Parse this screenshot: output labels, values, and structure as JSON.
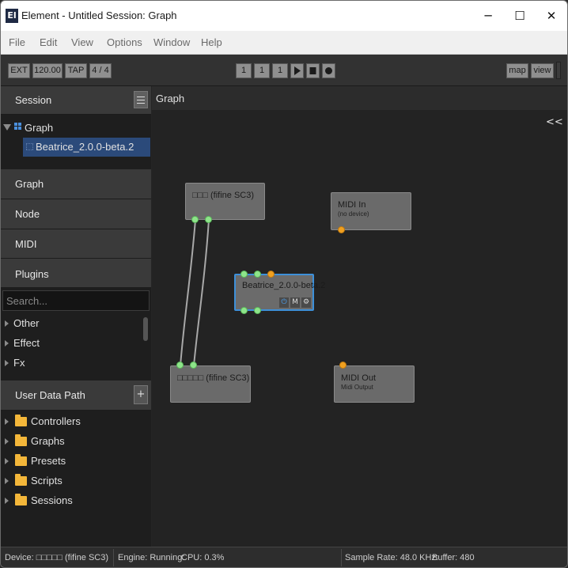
{
  "window": {
    "title": "Element - Untitled Session: Graph",
    "logo_text": "El",
    "minimize": "─",
    "maximize": "☐",
    "close": "✕"
  },
  "menu": [
    "File",
    "Edit",
    "View",
    "Options",
    "Window",
    "Help"
  ],
  "toolbar": {
    "ext": "EXT",
    "tempo": "120.00",
    "tap": "TAP",
    "meter": "4 / 4",
    "pos_bar": "1",
    "pos_beat": "1",
    "pos_tick": "1",
    "map": "map",
    "view": "view",
    "icons": [
      "play-icon",
      "stop-icon",
      "record-icon"
    ]
  },
  "sidebar": {
    "session_label": "Session",
    "tree": {
      "root": "Graph",
      "child": "Beatrice_2.0.0-beta.2"
    },
    "sections": [
      "Graph",
      "Node",
      "MIDI",
      "Plugins"
    ],
    "search_placeholder": "Search...",
    "plugin_categories": [
      "Other",
      "Effect",
      "Fx"
    ],
    "user_data_label": "User Data Path",
    "user_data_add": "+",
    "folders": [
      "Controllers",
      "Graphs",
      "Presets",
      "Scripts",
      "Sessions"
    ]
  },
  "graph": {
    "header": "Graph",
    "collapse": "<<",
    "nodes": [
      {
        "title": "□□□ (fifine SC3)",
        "subtitle": ""
      },
      {
        "title": "MIDI In",
        "subtitle": "(no device)"
      },
      {
        "title": "Beatrice_2.0.0-beta.2",
        "subtitle": ""
      },
      {
        "title": "□□□□□ (fifine SC3)",
        "subtitle": ""
      },
      {
        "title": "MIDI Out",
        "subtitle": "Midi Output"
      }
    ],
    "plugin_controls": {
      "power": "⏻",
      "mute": "M",
      "settings": "⚙"
    }
  },
  "status": {
    "device": "Device: □□□□□ (fifine SC3)",
    "engine": "Engine: Running:",
    "cpu": "CPU: 0.3%",
    "sample_rate": "Sample Rate: 48.0 KHz:",
    "buffer": "Buffer: 480"
  },
  "colors": {
    "port_audio": "#8ee48a",
    "port_midi": "#f0a020",
    "selection": "#3d90d9",
    "folder": "#f4b73a"
  }
}
